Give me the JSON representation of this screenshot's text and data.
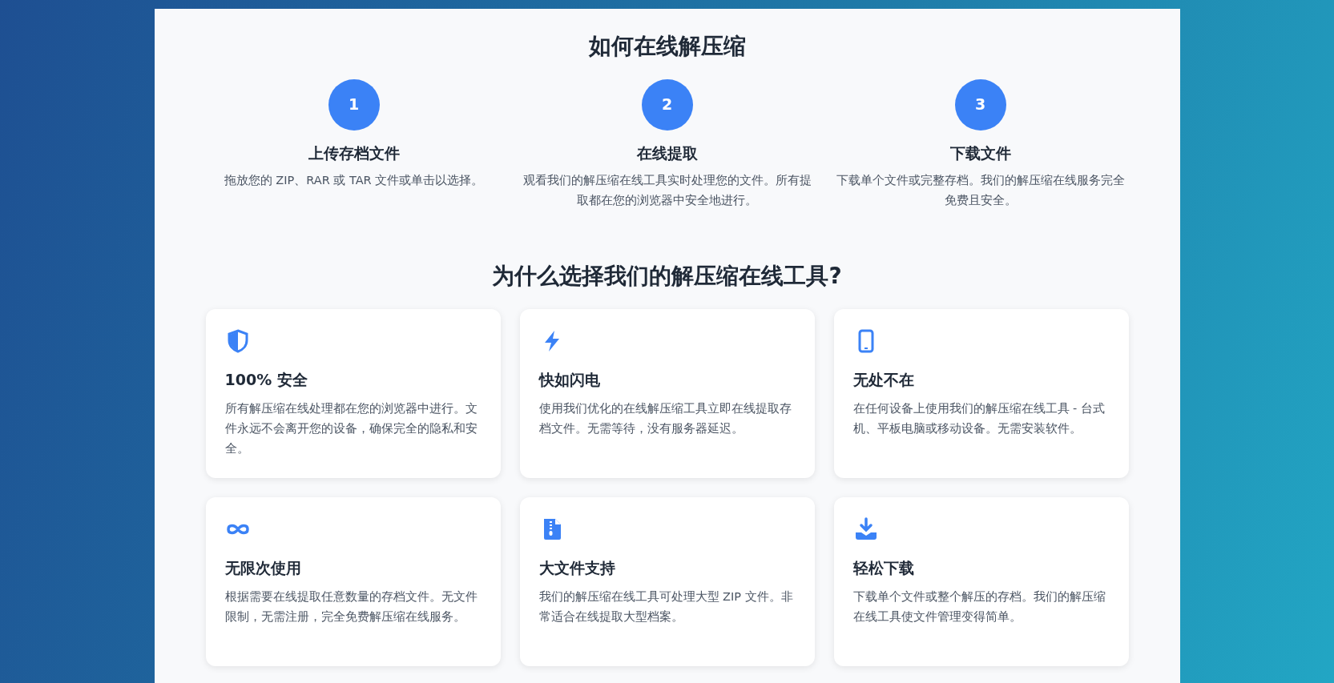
{
  "how_to": {
    "title": "如何在线解压缩",
    "steps": [
      {
        "number": "1",
        "title": "上传存档文件",
        "text": "拖放您的 ZIP、RAR 或 TAR 文件或单击以选择。"
      },
      {
        "number": "2",
        "title": "在线提取",
        "text": "观看我们的解压缩在线工具实时处理您的文件。所有提取都在您的浏览器中安全地进行。"
      },
      {
        "number": "3",
        "title": "下载文件",
        "text": "下载单个文件或完整存档。我们的解压缩在线服务完全免费且安全。"
      }
    ]
  },
  "why": {
    "title": "为什么选择我们的解压缩在线工具?",
    "features": [
      {
        "kind": "shield",
        "title": "100% 安全",
        "text": "所有解压缩在线处理都在您的浏览器中进行。文件永远不会离开您的设备，确保完全的隐私和安全。"
      },
      {
        "kind": "bolt",
        "title": "快如闪电",
        "text": "使用我们优化的在线解压缩工具立即在线提取存档文件。无需等待，没有服务器延迟。"
      },
      {
        "kind": "phone",
        "title": "无处不在",
        "text": "在任何设备上使用我们的解压缩在线工具 - 台式机、平板电脑或移动设备。无需安装软件。"
      },
      {
        "kind": "infinity",
        "title": "无限次使用",
        "text": "根据需要在线提取任意数量的存档文件。无文件限制，无需注册，完全免费解压缩在线服务。"
      },
      {
        "kind": "zipfile",
        "title": "大文件支持",
        "text": "我们的解压缩在线工具可处理大型 ZIP 文件。非常适合在线提取大型档案。"
      },
      {
        "kind": "download",
        "title": "轻松下载",
        "text": "下载单个文件或整个解压的存档。我们的解压缩在线工具使文件管理变得简单。"
      }
    ]
  }
}
